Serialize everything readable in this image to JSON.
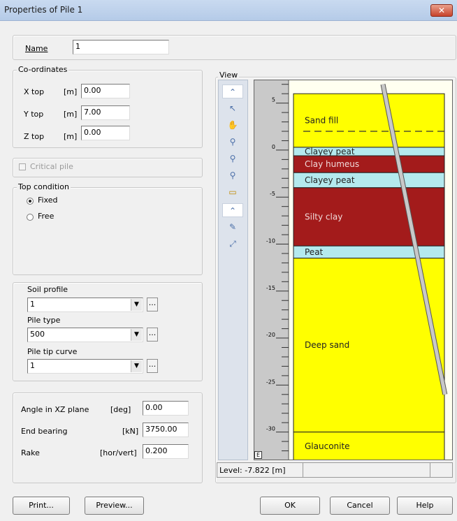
{
  "window": {
    "title": "Properties of Pile 1",
    "close_glyph": "✕"
  },
  "name": {
    "label": "Name",
    "value": "1"
  },
  "coordinates": {
    "legend": "Co-ordinates",
    "x": {
      "label": "X top",
      "unit": "[m]",
      "value": "0.00"
    },
    "y": {
      "label": "Y top",
      "unit": "[m]",
      "value": "7.00"
    },
    "z": {
      "label": "Z top",
      "unit": "[m]",
      "value": "0.00"
    }
  },
  "critical_pile": {
    "label": "Critical pile",
    "checked": false
  },
  "top_condition": {
    "legend": "Top condition",
    "options": [
      {
        "label": "Fixed",
        "selected": true
      },
      {
        "label": "Free",
        "selected": false
      }
    ]
  },
  "soil": {
    "soil_profile": {
      "label": "Soil profile",
      "value": "1"
    },
    "pile_type": {
      "label": "Pile type",
      "value": "500"
    },
    "pile_tip_curve": {
      "label": "Pile tip curve",
      "value": "1"
    },
    "ellipsis": "..."
  },
  "geometry": {
    "angle": {
      "label": "Angle in XZ plane",
      "unit": "[deg]",
      "value": "0.00"
    },
    "end_bearing": {
      "label": "End bearing",
      "unit": "[kN]",
      "value": "3750.00"
    },
    "rake": {
      "label": "Rake",
      "unit": "[hor/vert]",
      "value": "0.200"
    }
  },
  "view": {
    "legend": "View",
    "tools": [
      "collapse-icon",
      "select-arrow-icon",
      "pan-hand-icon",
      "zoom-in-icon",
      "zoom-out-icon",
      "zoom-limits-icon",
      "zoom-rectangle-icon",
      "collapse-icon",
      "measure-icon",
      "fit-icon"
    ],
    "level_text": "Level: -7.822 [m]",
    "ruler_ticks": [
      "5",
      "0",
      "-5",
      "-10",
      "-15",
      "-20",
      "-25",
      "-30"
    ]
  },
  "chart_data": {
    "type": "diagram",
    "axis": {
      "label": "Level",
      "unit": "m",
      "range": [
        7.5,
        -33
      ]
    },
    "layers": [
      {
        "name": "Sand fill",
        "top": 6.0,
        "bottom": 0.3,
        "color": "#ffff00"
      },
      {
        "name": "Clayey peat",
        "top": 0.3,
        "bottom": -0.6,
        "color": "#b4e9ee"
      },
      {
        "name": "Clay humeus",
        "top": -0.6,
        "bottom": -2.4,
        "color": "#a31b1b"
      },
      {
        "name": "Clayey peat",
        "top": -2.4,
        "bottom": -4.0,
        "color": "#b4e9ee"
      },
      {
        "name": "Silty clay",
        "top": -4.0,
        "bottom": -10.2,
        "color": "#a31b1b"
      },
      {
        "name": "Peat",
        "top": -10.2,
        "bottom": -11.5,
        "color": "#b4e9ee"
      },
      {
        "name": "Deep sand",
        "top": -11.5,
        "bottom": -30.0,
        "color": "#ffff00"
      },
      {
        "name": "Glauconite",
        "top": -30.0,
        "bottom": -33.0,
        "color": "#ffff00"
      }
    ],
    "phreatic_level": 2.0,
    "pile": {
      "top": 7.0,
      "tip": -26.0,
      "rake": 0.2
    }
  },
  "buttons": {
    "print": "Print...",
    "preview": "Preview...",
    "ok": "OK",
    "cancel": "Cancel",
    "help": "Help"
  }
}
